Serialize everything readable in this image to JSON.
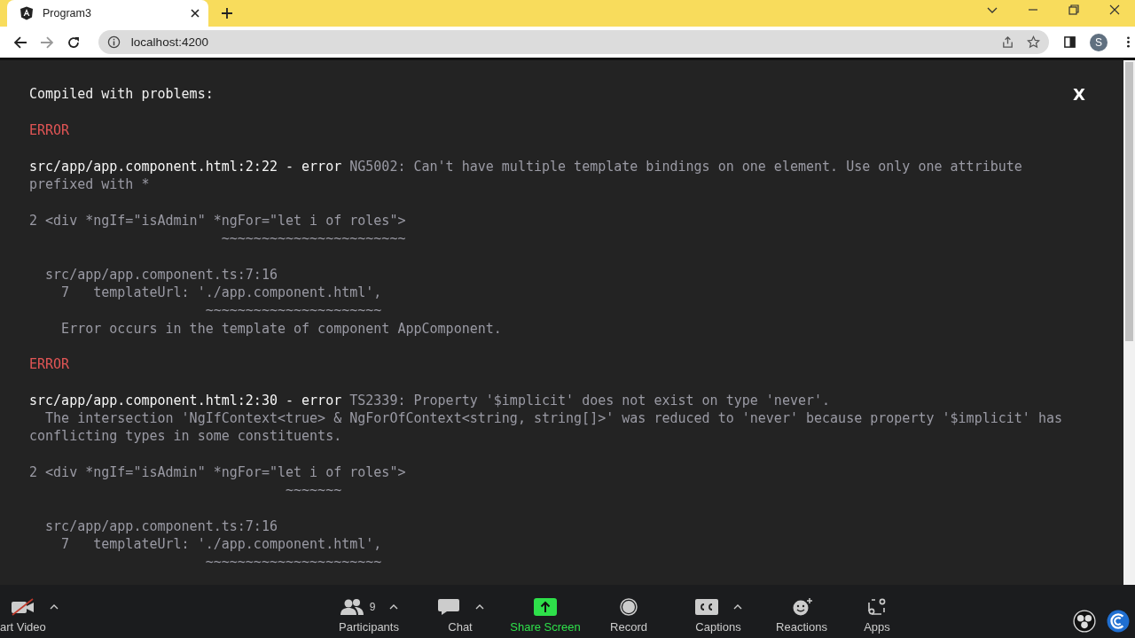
{
  "browser": {
    "tab": {
      "title": "Program3"
    },
    "url": "localhost:4200",
    "profile": "S"
  },
  "overlay": {
    "title": "Compiled with problems:",
    "close": "X",
    "errors": [
      {
        "label": "ERROR",
        "location": "src/app/app.component.html:2:22 - error",
        "message": "NG5002: Can't have multiple template bindings on one element. Use only one attribute prefixed with *",
        "code": "2 <div *ngIf=\"isAdmin\" *ngFor=\"let i of roles\">",
        "squiggle": "                        ~~~~~~~~~~~~~~~~~~~~~~~",
        "trace_file": "  src/app/app.component.ts:7:16",
        "trace_code": "    7   templateUrl: './app.component.html',",
        "trace_squiggle": "                      ~~~~~~~~~~~~~~~~~~~~~~",
        "note": "    Error occurs in the template of component AppComponent."
      },
      {
        "label": "ERROR",
        "location": "src/app/app.component.html:2:30 - error",
        "message": "TS2339: Property '$implicit' does not exist on type 'never'.",
        "detail": "  The intersection 'NgIfContext<true> & NgForOfContext<string, string[]>' was reduced to 'never' because property '$implicit' has conflicting types in some constituents.",
        "code": "2 <div *ngIf=\"isAdmin\" *ngFor=\"let i of roles\">",
        "squiggle": "                                ~~~~~~~",
        "trace_file": "  src/app/app.component.ts:7:16",
        "trace_code": "    7   templateUrl: './app.component.html',",
        "trace_squiggle": "                      ~~~~~~~~~~~~~~~~~~~~~~"
      }
    ]
  },
  "meeting_toolbar": [
    {
      "kind": "video",
      "label": "art Video",
      "caret": true
    },
    {
      "kind": "participants",
      "label": "Participants",
      "count": "9",
      "caret": true
    },
    {
      "kind": "chat",
      "label": "Chat",
      "caret": true
    },
    {
      "kind": "share",
      "label": "Share Screen",
      "caret": false
    },
    {
      "kind": "record",
      "label": "Record",
      "caret": false
    },
    {
      "kind": "captions",
      "label": "Captions",
      "caret": true
    },
    {
      "kind": "reactions",
      "label": "Reactions",
      "caret": false
    },
    {
      "kind": "apps",
      "label": "Apps",
      "caret": false
    }
  ]
}
